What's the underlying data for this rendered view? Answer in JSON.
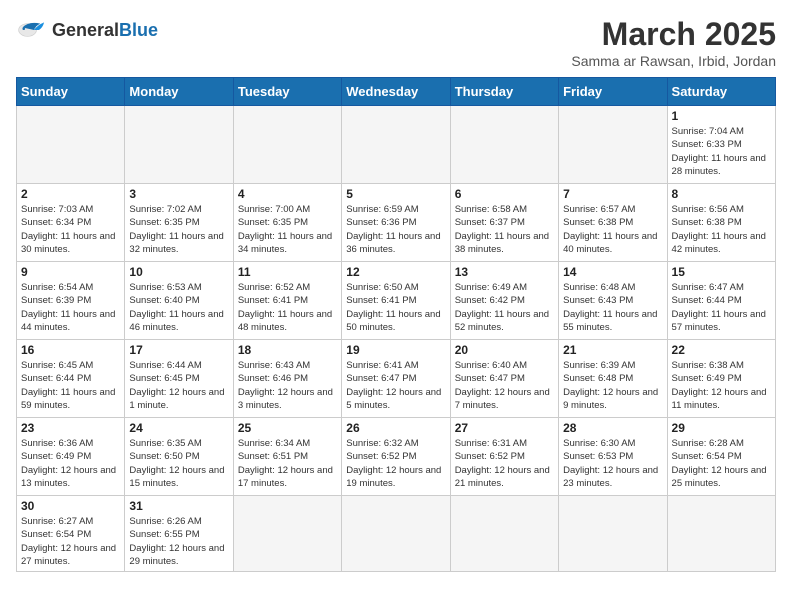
{
  "header": {
    "logo_general": "General",
    "logo_blue": "Blue",
    "title": "March 2025",
    "subtitle": "Samma ar Rawsan, Irbid, Jordan"
  },
  "weekdays": [
    "Sunday",
    "Monday",
    "Tuesday",
    "Wednesday",
    "Thursday",
    "Friday",
    "Saturday"
  ],
  "weeks": [
    [
      {
        "day": "",
        "info": ""
      },
      {
        "day": "",
        "info": ""
      },
      {
        "day": "",
        "info": ""
      },
      {
        "day": "",
        "info": ""
      },
      {
        "day": "",
        "info": ""
      },
      {
        "day": "",
        "info": ""
      },
      {
        "day": "1",
        "info": "Sunrise: 7:04 AM\nSunset: 6:33 PM\nDaylight: 11 hours\nand 28 minutes."
      }
    ],
    [
      {
        "day": "2",
        "info": "Sunrise: 7:03 AM\nSunset: 6:34 PM\nDaylight: 11 hours\nand 30 minutes."
      },
      {
        "day": "3",
        "info": "Sunrise: 7:02 AM\nSunset: 6:35 PM\nDaylight: 11 hours\nand 32 minutes."
      },
      {
        "day": "4",
        "info": "Sunrise: 7:00 AM\nSunset: 6:35 PM\nDaylight: 11 hours\nand 34 minutes."
      },
      {
        "day": "5",
        "info": "Sunrise: 6:59 AM\nSunset: 6:36 PM\nDaylight: 11 hours\nand 36 minutes."
      },
      {
        "day": "6",
        "info": "Sunrise: 6:58 AM\nSunset: 6:37 PM\nDaylight: 11 hours\nand 38 minutes."
      },
      {
        "day": "7",
        "info": "Sunrise: 6:57 AM\nSunset: 6:38 PM\nDaylight: 11 hours\nand 40 minutes."
      },
      {
        "day": "8",
        "info": "Sunrise: 6:56 AM\nSunset: 6:38 PM\nDaylight: 11 hours\nand 42 minutes."
      }
    ],
    [
      {
        "day": "9",
        "info": "Sunrise: 6:54 AM\nSunset: 6:39 PM\nDaylight: 11 hours\nand 44 minutes."
      },
      {
        "day": "10",
        "info": "Sunrise: 6:53 AM\nSunset: 6:40 PM\nDaylight: 11 hours\nand 46 minutes."
      },
      {
        "day": "11",
        "info": "Sunrise: 6:52 AM\nSunset: 6:41 PM\nDaylight: 11 hours\nand 48 minutes."
      },
      {
        "day": "12",
        "info": "Sunrise: 6:50 AM\nSunset: 6:41 PM\nDaylight: 11 hours\nand 50 minutes."
      },
      {
        "day": "13",
        "info": "Sunrise: 6:49 AM\nSunset: 6:42 PM\nDaylight: 11 hours\nand 52 minutes."
      },
      {
        "day": "14",
        "info": "Sunrise: 6:48 AM\nSunset: 6:43 PM\nDaylight: 11 hours\nand 55 minutes."
      },
      {
        "day": "15",
        "info": "Sunrise: 6:47 AM\nSunset: 6:44 PM\nDaylight: 11 hours\nand 57 minutes."
      }
    ],
    [
      {
        "day": "16",
        "info": "Sunrise: 6:45 AM\nSunset: 6:44 PM\nDaylight: 11 hours\nand 59 minutes."
      },
      {
        "day": "17",
        "info": "Sunrise: 6:44 AM\nSunset: 6:45 PM\nDaylight: 12 hours\nand 1 minute."
      },
      {
        "day": "18",
        "info": "Sunrise: 6:43 AM\nSunset: 6:46 PM\nDaylight: 12 hours\nand 3 minutes."
      },
      {
        "day": "19",
        "info": "Sunrise: 6:41 AM\nSunset: 6:47 PM\nDaylight: 12 hours\nand 5 minutes."
      },
      {
        "day": "20",
        "info": "Sunrise: 6:40 AM\nSunset: 6:47 PM\nDaylight: 12 hours\nand 7 minutes."
      },
      {
        "day": "21",
        "info": "Sunrise: 6:39 AM\nSunset: 6:48 PM\nDaylight: 12 hours\nand 9 minutes."
      },
      {
        "day": "22",
        "info": "Sunrise: 6:38 AM\nSunset: 6:49 PM\nDaylight: 12 hours\nand 11 minutes."
      }
    ],
    [
      {
        "day": "23",
        "info": "Sunrise: 6:36 AM\nSunset: 6:49 PM\nDaylight: 12 hours\nand 13 minutes."
      },
      {
        "day": "24",
        "info": "Sunrise: 6:35 AM\nSunset: 6:50 PM\nDaylight: 12 hours\nand 15 minutes."
      },
      {
        "day": "25",
        "info": "Sunrise: 6:34 AM\nSunset: 6:51 PM\nDaylight: 12 hours\nand 17 minutes."
      },
      {
        "day": "26",
        "info": "Sunrise: 6:32 AM\nSunset: 6:52 PM\nDaylight: 12 hours\nand 19 minutes."
      },
      {
        "day": "27",
        "info": "Sunrise: 6:31 AM\nSunset: 6:52 PM\nDaylight: 12 hours\nand 21 minutes."
      },
      {
        "day": "28",
        "info": "Sunrise: 6:30 AM\nSunset: 6:53 PM\nDaylight: 12 hours\nand 23 minutes."
      },
      {
        "day": "29",
        "info": "Sunrise: 6:28 AM\nSunset: 6:54 PM\nDaylight: 12 hours\nand 25 minutes."
      }
    ],
    [
      {
        "day": "30",
        "info": "Sunrise: 6:27 AM\nSunset: 6:54 PM\nDaylight: 12 hours\nand 27 minutes."
      },
      {
        "day": "31",
        "info": "Sunrise: 6:26 AM\nSunset: 6:55 PM\nDaylight: 12 hours\nand 29 minutes."
      },
      {
        "day": "",
        "info": ""
      },
      {
        "day": "",
        "info": ""
      },
      {
        "day": "",
        "info": ""
      },
      {
        "day": "",
        "info": ""
      },
      {
        "day": "",
        "info": ""
      }
    ]
  ]
}
